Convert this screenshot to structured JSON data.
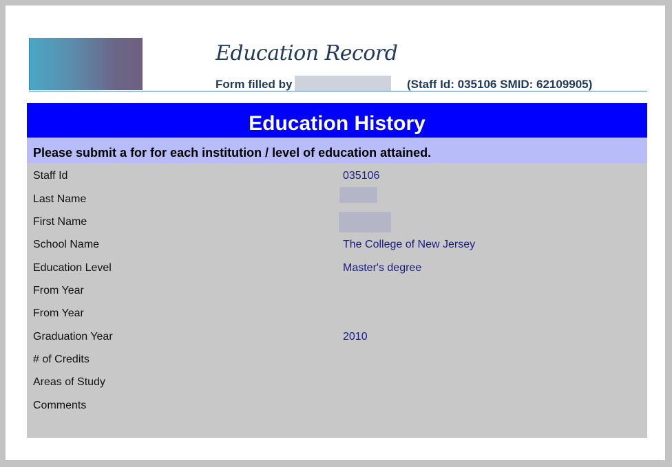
{
  "header": {
    "title": "Education Record",
    "filled_by_label": "Form filled by",
    "staff_info": "(Staff Id: 035106  SMID: 62109905)"
  },
  "section": {
    "title": "Education History",
    "instructions": "Please submit a for for each institution / level of education attained."
  },
  "fields": [
    {
      "label": "Staff Id",
      "value": "035106"
    },
    {
      "label": "Last Name",
      "value": ""
    },
    {
      "label": "First Name",
      "value": ""
    },
    {
      "label": "School Name",
      "value": "The College of New Jersey"
    },
    {
      "label": "Education Level",
      "value": "Master's degree"
    },
    {
      "label": "From Year",
      "value": ""
    },
    {
      "label": "From Year",
      "value": ""
    },
    {
      "label": "Graduation Year",
      "value": "2010"
    },
    {
      "label": "# of Credits",
      "value": ""
    },
    {
      "label": "Areas of Study",
      "value": ""
    },
    {
      "label": "Comments",
      "value": ""
    }
  ]
}
